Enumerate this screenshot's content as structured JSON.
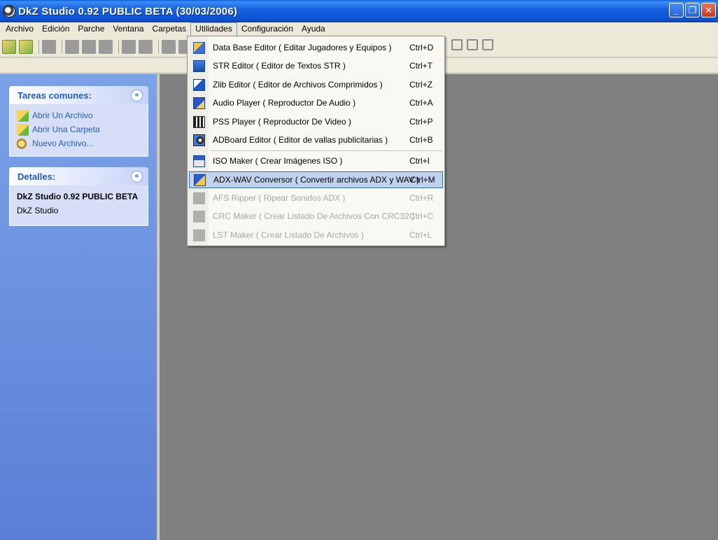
{
  "window": {
    "title": "DkZ Studio 0.92 PUBLIC BETA (30/03/2006)",
    "minimize": "_",
    "maximize": "❐",
    "close": "✕"
  },
  "menubar": {
    "items": [
      "Archivo",
      "Edición",
      "Parche",
      "Ventana",
      "Carpetas",
      "Utilidades",
      "Configuración",
      "Ayuda"
    ],
    "active": "Utilidades"
  },
  "taskpane": {
    "common": {
      "title": "Tareas comunes:",
      "chevron": "«",
      "tasks": [
        {
          "label": "Abrir Un Archivo",
          "icon": "open-file-icon"
        },
        {
          "label": "Abrir Una Carpeta",
          "icon": "open-folder-icon"
        },
        {
          "label": "Nuevo Archivo...",
          "icon": "new-file-icon"
        }
      ]
    },
    "details": {
      "title": "Detalles:",
      "chevron": "«",
      "app_name": "DkZ Studio 0.92 PUBLIC BETA",
      "app_sub": "DkZ Studio"
    }
  },
  "utilities_menu": {
    "items": [
      {
        "label": "Data Base Editor ( Editar Jugadores y Equipos )",
        "shortcut": "Ctrl+D",
        "icon": "database-icon",
        "enabled": true
      },
      {
        "label": "STR Editor ( Editor de Textos STR )",
        "shortcut": "Ctrl+T",
        "icon": "str-icon",
        "enabled": true
      },
      {
        "label": "Zlib Editor ( Editor de Archivos Comprimidos )",
        "shortcut": "Ctrl+Z",
        "icon": "zlib-icon",
        "enabled": true
      },
      {
        "label": "Audio Player ( Reproductor De Audio )",
        "shortcut": "Ctrl+A",
        "icon": "audio-icon",
        "enabled": true
      },
      {
        "label": "PSS Player ( Reproductor De Video )",
        "shortcut": "Ctrl+P",
        "icon": "video-icon",
        "enabled": true
      },
      {
        "label": "ADBoard Editor ( Editor de vallas publicitarias )",
        "shortcut": "Ctrl+B",
        "icon": "billboard-icon",
        "enabled": true
      },
      {
        "label": "ISO Maker ( Crear Imágenes ISO )",
        "shortcut": "Ctrl+I",
        "icon": "iso-icon",
        "enabled": true
      },
      {
        "label": "ADX-WAV Conversor ( Convertir archivos ADX y WAV )",
        "shortcut": "Ctrl+M",
        "icon": "convert-icon",
        "enabled": true,
        "highlighted": true
      },
      {
        "label": "AFS Ripper ( Ripear Sonidos ADX )",
        "shortcut": "Ctrl+R",
        "icon": "afs-icon",
        "enabled": false
      },
      {
        "label": "CRC Maker ( Crear Listado De Archivos Con CRC32 )",
        "shortcut": "Ctrl+C",
        "icon": "crc-icon",
        "enabled": false
      },
      {
        "label": "LST Maker ( Crear Listado De Archivos )",
        "shortcut": "Ctrl+L",
        "icon": "lst-icon",
        "enabled": false
      }
    ]
  }
}
